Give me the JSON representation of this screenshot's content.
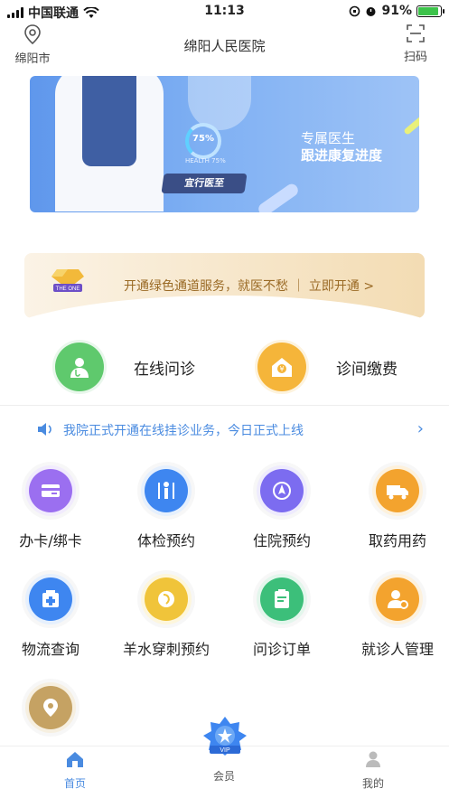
{
  "status": {
    "carrier": "中国联通",
    "time": "11:13",
    "battery": "91%",
    "battery_level": 0.91
  },
  "header": {
    "city": "绵阳市",
    "title": "绵阳人民医院",
    "scan_label": "扫码"
  },
  "banner": {
    "ring_value": "75%",
    "health_text": "HEALTH 75%",
    "pad_text": "宜行医至",
    "line1": "专属医生",
    "line2": "跟进康复进度"
  },
  "promo": {
    "badge_text": "THE ONE",
    "text": "开通绿色通道服务，就医不愁 ｜ 立即开通 >"
  },
  "quick": [
    {
      "label": "在线问诊",
      "color": "#5fc96d"
    },
    {
      "label": "诊间缴费",
      "color": "#f5b53a"
    }
  ],
  "notice": {
    "text": "我院正式开通在线挂诊业务，今日正式上线",
    "chevron": "›"
  },
  "services": [
    {
      "label": "办卡/绑卡",
      "icon": "card-icon",
      "color": "#9b6ff0"
    },
    {
      "label": "体检预约",
      "icon": "checkup-icon",
      "color": "#3e86f0"
    },
    {
      "label": "住院预约",
      "icon": "compass-icon",
      "color": "#7c6cf0"
    },
    {
      "label": "取药用药",
      "icon": "truck-icon",
      "color": "#f3a32e"
    },
    {
      "label": "物流查询",
      "icon": "medicine-box-icon",
      "color": "#3e86f0"
    },
    {
      "label": "羊水穿刺预约",
      "icon": "pregnancy-icon",
      "color": "#f0c43a"
    },
    {
      "label": "问诊订单",
      "icon": "clipboard-icon",
      "color": "#3cbf7a"
    },
    {
      "label": "就诊人管理",
      "icon": "user-settings-icon",
      "color": "#f3a32e"
    },
    {
      "label": "",
      "icon": "location-icon",
      "color": "#c5a263"
    }
  ],
  "tabs": [
    {
      "label": "首页",
      "icon": "home-icon",
      "active": true
    },
    {
      "label": "会员",
      "icon": "vip-icon",
      "active": false
    },
    {
      "label": "我的",
      "icon": "profile-icon",
      "active": false
    }
  ],
  "vip_text": "VIP"
}
